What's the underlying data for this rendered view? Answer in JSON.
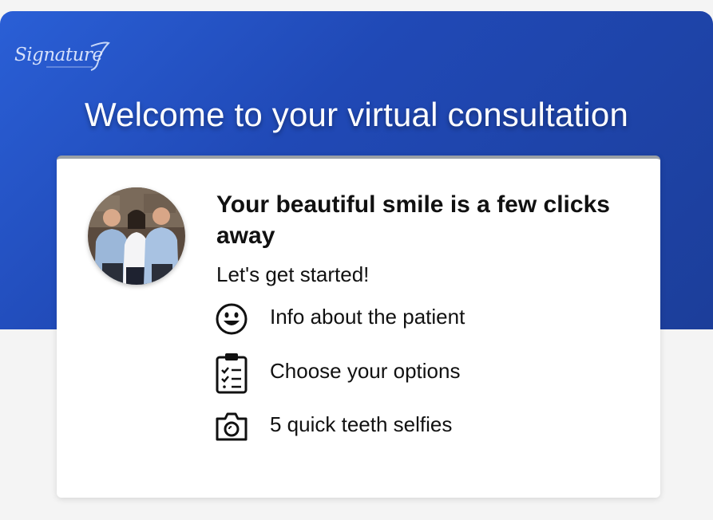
{
  "header": {
    "logo_text": "Signature",
    "title": "Welcome to your virtual consultation"
  },
  "card": {
    "headline": "Your beautiful smile is a few clicks away",
    "subline": "Let's get started!",
    "steps": [
      {
        "icon": "smiley-face-icon",
        "label": "Info about the patient"
      },
      {
        "icon": "clipboard-checklist-icon",
        "label": "Choose your options"
      },
      {
        "icon": "camera-icon",
        "label": "5 quick teeth selfies"
      }
    ]
  },
  "colors": {
    "header_blue": "#2049b6",
    "card_background": "#ffffff",
    "page_background": "#f4f4f4"
  }
}
